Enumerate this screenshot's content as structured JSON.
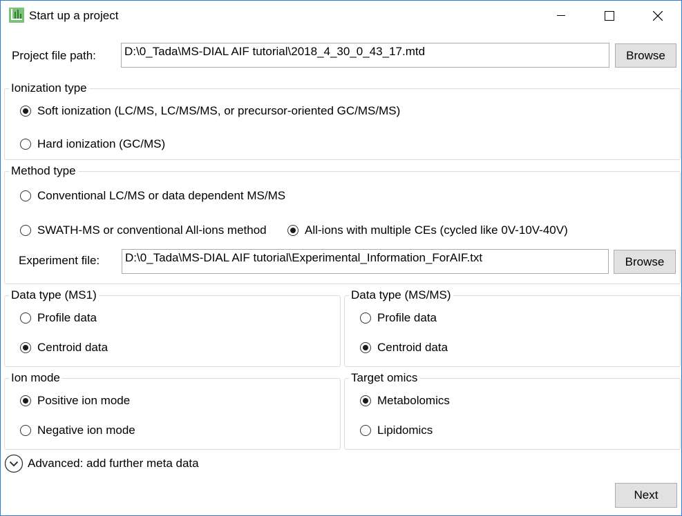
{
  "window": {
    "title": "Start up a project",
    "app_icon": "msdial-app-icon"
  },
  "project": {
    "label": "Project file path:",
    "value": "D:\\0_Tada\\MS-DIAL AIF tutorial\\2018_4_30_0_43_17.mtd",
    "browse_label": "Browse"
  },
  "ionization": {
    "title": "Ionization type",
    "options": [
      {
        "label": "Soft ionization (LC/MS, LC/MS/MS, or precursor-oriented GC/MS/MS)",
        "checked": true
      },
      {
        "label": "Hard ionization (GC/MS)",
        "checked": false
      }
    ]
  },
  "method": {
    "title": "Method type",
    "options": [
      {
        "label": "Conventional LC/MS or data dependent MS/MS",
        "checked": false
      },
      {
        "label": "SWATH-MS or conventional All-ions method",
        "checked": false
      },
      {
        "label": "All-ions with multiple CEs (cycled like 0V-10V-40V)",
        "checked": true
      }
    ],
    "experiment_label": "Experiment file:",
    "experiment_value": "D:\\0_Tada\\MS-DIAL AIF tutorial\\Experimental_Information_ForAIF.txt",
    "browse_label": "Browse"
  },
  "data_ms1": {
    "title": "Data type (MS1)",
    "options": [
      {
        "label": "Profile data",
        "checked": false
      },
      {
        "label": "Centroid data",
        "checked": true
      }
    ]
  },
  "data_msms": {
    "title": "Data type (MS/MS)",
    "options": [
      {
        "label": "Profile data",
        "checked": false
      },
      {
        "label": "Centroid data",
        "checked": true
      }
    ]
  },
  "ion_mode": {
    "title": "Ion mode",
    "options": [
      {
        "label": "Positive ion mode",
        "checked": true
      },
      {
        "label": "Negative ion mode",
        "checked": false
      }
    ]
  },
  "target_omics": {
    "title": "Target omics",
    "options": [
      {
        "label": "Metabolomics",
        "checked": true
      },
      {
        "label": "Lipidomics",
        "checked": false
      }
    ]
  },
  "advanced": {
    "label": "Advanced: add further meta data"
  },
  "footer": {
    "next_label": "Next"
  }
}
